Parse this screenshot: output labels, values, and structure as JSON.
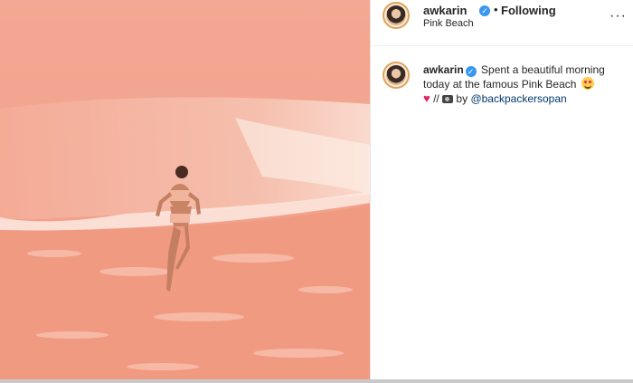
{
  "post": {
    "username": "awkarin",
    "follow_separator": "•",
    "follow_status": "Following",
    "location": "Pink Beach",
    "more_label": "···",
    "caption_text": "Spent a beautiful morning today at the famous Pink Beach",
    "caption_line2_sep": "//",
    "caption_by": "by",
    "mention": "@backpackersopan",
    "verified_mark": "✓"
  },
  "colors": {
    "verified": "#3897f0",
    "mention": "#00376b",
    "sand": "#f2a58f",
    "heart": "#e0245e"
  },
  "icons": [
    "verified-badge-icon",
    "more-options-icon",
    "heart-emoji-icon",
    "camera-emoji-icon",
    "smiling-face-emoji-icon"
  ]
}
